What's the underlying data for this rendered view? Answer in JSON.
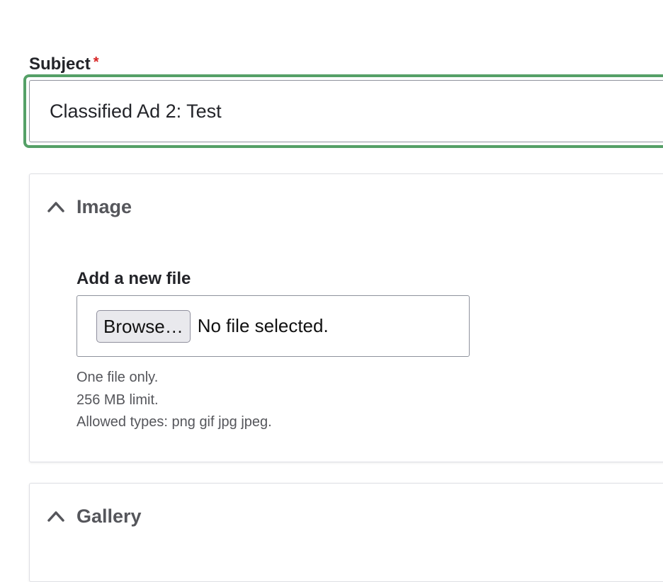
{
  "subject": {
    "label": "Subject",
    "required_mark": "*",
    "value": "Classified Ad 2: Test"
  },
  "image_section": {
    "title": "Image",
    "expanded": true,
    "chevron_icon": "chevron-up-icon",
    "file_field": {
      "label": "Add a new file",
      "browse_label": "Browse…",
      "status": "No file selected."
    },
    "help": {
      "line1": "One file only.",
      "line2": "256 MB limit.",
      "line3": "Allowed types: png gif jpg jpeg."
    }
  },
  "gallery_section": {
    "title": "Gallery",
    "expanded": true,
    "chevron_icon": "chevron-up-icon"
  },
  "colors": {
    "focus_ring": "#55a067",
    "required": "#d72222",
    "text": "#232429",
    "muted": "#55565b"
  }
}
